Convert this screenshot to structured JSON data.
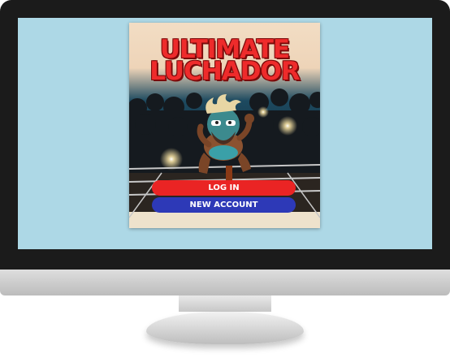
{
  "game": {
    "title_line1": "ULTIMATE",
    "title_line2": "LUCHADOR",
    "login_label": "LOG IN",
    "new_account_label": "NEW ACCOUNT"
  },
  "colors": {
    "screen_background": "#add8e6",
    "login_button": "#ea2424",
    "new_account_button": "#2d39b7",
    "title_text": "#ee2b2b"
  }
}
